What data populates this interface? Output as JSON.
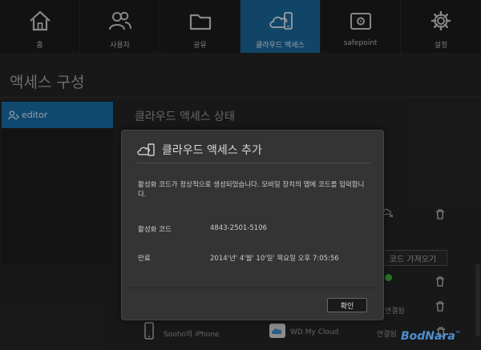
{
  "nav": {
    "items": [
      {
        "label": "홈",
        "icon": "home-icon"
      },
      {
        "label": "사용자",
        "icon": "users-icon"
      },
      {
        "label": "공유",
        "icon": "folder-icon"
      },
      {
        "label": "클라우드 액세스",
        "icon": "cloud-mobile-icon"
      },
      {
        "label": "safepoint",
        "icon": "safe-icon"
      },
      {
        "label": "설정",
        "icon": "gear-icon"
      }
    ],
    "active_index": 3
  },
  "page": {
    "title": "액세스 구성"
  },
  "sidebar": {
    "selected_user": "editor"
  },
  "section": {
    "title": "클라우드 액세스 상태"
  },
  "background": {
    "generate_code_button": "코드 가져오기",
    "status_connected_1": "연결됨",
    "device_name": "Sooho의 iPhone",
    "device_target": "WD My Cloud",
    "status_connected_2": "연결됨"
  },
  "dialog": {
    "title": "클라우드 액세스 추가",
    "message": "활성화 코드가 정상적으로 생성되었습니다. 모바일 장치의 앱에 코드를 입력합니다.",
    "code_label": "활성화 코드",
    "code_value": "4843-2501-5106",
    "expiry_label": "만료",
    "expiry_value": "2014'년' 4'월' 10'일' 목요일 오후 7:05:56",
    "ok_label": "확인"
  },
  "watermark": {
    "text": "BodNara",
    "mark": "™"
  },
  "colors": {
    "accent": "#1b6aa0",
    "background": "#262626",
    "dialog": "#343434",
    "status_green": "#3dbb3d"
  }
}
